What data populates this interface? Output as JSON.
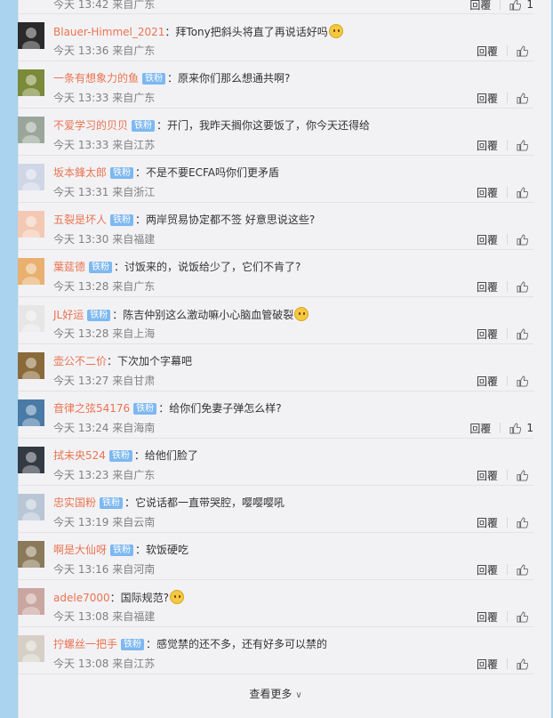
{
  "partial_item": {
    "time": "今天 13:42 来自广东",
    "reply": "回覆",
    "likes": "1"
  },
  "comments": [
    {
      "user": "Blauer-Himmel_2021",
      "badge": "",
      "text": "拜Tony把斜头将直了再说话好吗",
      "emoji": true,
      "time": "今天 13:36 来自广东",
      "reply": "回覆",
      "likes": "",
      "avatar": "#2a2a2a"
    },
    {
      "user": "一条有想象力的鱼",
      "badge": "铁粉",
      "text": "原来你们那么想通共啊?",
      "emoji": false,
      "time": "今天 13:33 来自广东",
      "reply": "回覆",
      "likes": "",
      "avatar": "#7a8a3a"
    },
    {
      "user": "不爱学习的贝贝",
      "badge": "铁粉",
      "text": "开门，我昨天搁你这要饭了，你今天还得给",
      "emoji": false,
      "time": "今天 13:33 来自江苏",
      "reply": "回覆",
      "likes": "",
      "avatar": "#9aa69a"
    },
    {
      "user": "坂本鋒太郎",
      "badge": "铁粉",
      "text": "不是不要ECFA吗你们更矛盾",
      "emoji": false,
      "time": "今天 13:31 来自浙江",
      "reply": "回覆",
      "likes": "",
      "avatar": "#cfd6e6"
    },
    {
      "user": "五裂是坏人",
      "badge": "铁粉",
      "text": "两岸贸易协定都不签 好意思说这些?",
      "emoji": false,
      "time": "今天 13:30 来自福建",
      "reply": "回覆",
      "likes": "",
      "avatar": "#f3c9b4"
    },
    {
      "user": "葉莚德",
      "badge": "铁粉",
      "text": "讨饭来的，说饭给少了，它们不肯了?",
      "emoji": false,
      "time": "今天 13:28 来自广东",
      "reply": "回覆",
      "likes": "",
      "avatar": "#e9b070"
    },
    {
      "user": "JL好运",
      "badge": "铁粉",
      "text": "陈吉仲别这么激动嘛小心脑血管破裂",
      "emoji": true,
      "time": "今天 13:28 来自上海",
      "reply": "回覆",
      "likes": "",
      "avatar": "#e6e6e6"
    },
    {
      "user": "壶公不二价",
      "badge": "",
      "text": "下次加个字幕吧",
      "emoji": false,
      "time": "今天 13:27 来自甘肃",
      "reply": "回覆",
      "likes": "",
      "avatar": "#8a6a3a"
    },
    {
      "user": "音律之弦54176",
      "badge": "铁粉",
      "text": "给你们免妻子弹怎么样?",
      "emoji": false,
      "time": "今天 13:24 来自海南",
      "reply": "回覆",
      "likes": "1",
      "avatar": "#4a7aa6"
    },
    {
      "user": "拭未央524",
      "badge": "铁粉",
      "text": "给他们脸了",
      "emoji": false,
      "time": "今天 13:23 来自广东",
      "reply": "回覆",
      "likes": "",
      "avatar": "#333a44"
    },
    {
      "user": "忠实国粉",
      "badge": "铁粉",
      "text": "它说话都一直带哭腔，嘤嘤嘤吼",
      "emoji": false,
      "time": "今天 13:19 来自云南",
      "reply": "回覆",
      "likes": "",
      "avatar": "#b8c6d6"
    },
    {
      "user": "啊是大仙呀",
      "badge": "铁粉",
      "text": "软饭硬吃",
      "emoji": false,
      "time": "今天 13:16 来自河南",
      "reply": "回覆",
      "likes": "",
      "avatar": "#8a7a5a"
    },
    {
      "user": "adele7000",
      "badge": "",
      "text": "国际规范?",
      "emoji": true,
      "time": "今天 13:08 来自福建",
      "reply": "回覆",
      "likes": "",
      "avatar": "#c9a6a0"
    },
    {
      "user": "拧螺丝一把手",
      "badge": "铁粉",
      "text": "感觉禁的还不多，还有好多可以禁的",
      "emoji": false,
      "time": "今天 13:08 来自江苏",
      "reply": "回覆",
      "likes": "",
      "avatar": "#d6cfc6"
    }
  ],
  "load_more": "查看更多"
}
